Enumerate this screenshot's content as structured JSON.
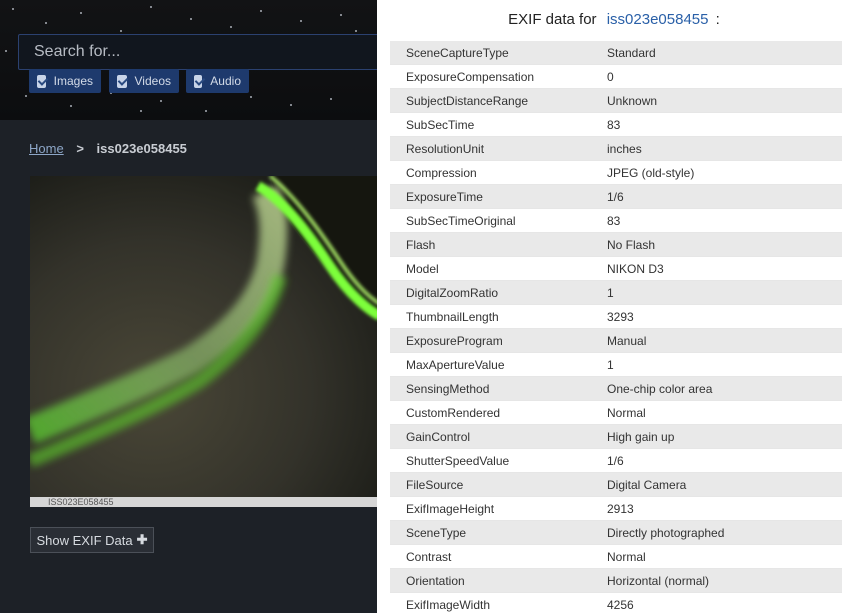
{
  "search": {
    "placeholder": "Search for..."
  },
  "filters": [
    {
      "label": "Images",
      "checked": true
    },
    {
      "label": "Videos",
      "checked": true
    },
    {
      "label": "Audio",
      "checked": true
    }
  ],
  "breadcrumb": {
    "home": "Home",
    "separator": ">",
    "current": "iss023e058455"
  },
  "photo": {
    "caption": "ISS023E058455"
  },
  "exif_button": {
    "label": "Show EXIF Data",
    "icon": "plus-icon"
  },
  "panel": {
    "title_prefix": "EXIF data for",
    "title_id": "iss023e058455",
    "title_suffix": ":",
    "rows": [
      {
        "key": "SceneCaptureType",
        "value": "Standard"
      },
      {
        "key": "ExposureCompensation",
        "value": "0"
      },
      {
        "key": "SubjectDistanceRange",
        "value": "Unknown"
      },
      {
        "key": "SubSecTime",
        "value": "83"
      },
      {
        "key": "ResolutionUnit",
        "value": "inches"
      },
      {
        "key": "Compression",
        "value": "JPEG (old-style)"
      },
      {
        "key": "ExposureTime",
        "value": "1/6"
      },
      {
        "key": "SubSecTimeOriginal",
        "value": "83"
      },
      {
        "key": "Flash",
        "value": "No Flash"
      },
      {
        "key": "Model",
        "value": "NIKON D3"
      },
      {
        "key": "DigitalZoomRatio",
        "value": "1"
      },
      {
        "key": "ThumbnailLength",
        "value": "3293"
      },
      {
        "key": "ExposureProgram",
        "value": "Manual"
      },
      {
        "key": "MaxApertureValue",
        "value": "1"
      },
      {
        "key": "SensingMethod",
        "value": "One-chip color area"
      },
      {
        "key": "CustomRendered",
        "value": "Normal"
      },
      {
        "key": "GainControl",
        "value": "High gain up"
      },
      {
        "key": "ShutterSpeedValue",
        "value": "1/6"
      },
      {
        "key": "FileSource",
        "value": "Digital Camera"
      },
      {
        "key": "ExifImageHeight",
        "value": "2913"
      },
      {
        "key": "SceneType",
        "value": "Directly photographed"
      },
      {
        "key": "Contrast",
        "value": "Normal"
      },
      {
        "key": "Orientation",
        "value": "Horizontal (normal)"
      },
      {
        "key": "ExifImageWidth",
        "value": "4256"
      }
    ]
  },
  "colors": {
    "link": "#2a60a8",
    "filter_bg": "#1e3a6d",
    "page_bg": "#1d2127"
  }
}
